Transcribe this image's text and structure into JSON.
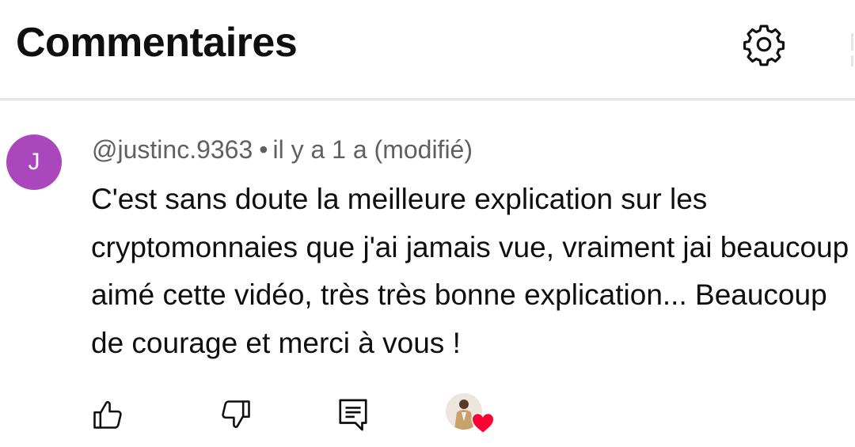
{
  "header": {
    "title": "Commentaires",
    "settings_icon": "gear-icon"
  },
  "comment": {
    "avatar_letter": "J",
    "avatar_color": "#ab47bc",
    "author": "@justinc.9363",
    "separator": "•",
    "timestamp": "il y a 1 a (modifié)",
    "text": "C'est sans doute la meilleure explication sur les cryptomonnaies que j'ai jamais vue, vraiment jai beaucoup aimé cette vidéo, très très bonne explication... Beaucoup de courage et merci à vous !"
  },
  "actions": {
    "like_icon": "thumbs-up-icon",
    "dislike_icon": "thumbs-down-icon",
    "reply_icon": "reply-comment-icon",
    "creator_heart_icon": "heart-icon",
    "heart_color": "#ff0033"
  }
}
